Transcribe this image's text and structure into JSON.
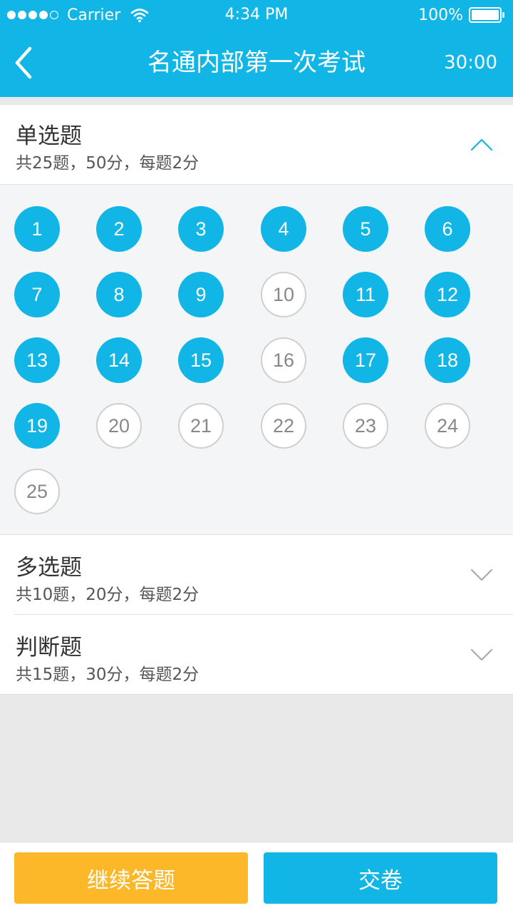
{
  "status_bar": {
    "carrier": "Carrier",
    "time": "4:34 PM",
    "battery": "100%",
    "signal_bars": 4
  },
  "nav": {
    "back_icon": "chevron-left-icon",
    "title": "名通内部第一次考试",
    "timer": "30:00"
  },
  "sections": {
    "single": {
      "title": "单选题",
      "subtitle": "共25题，50分，每题2分",
      "expanded": true,
      "toggle_icon": "chevron-up-icon",
      "questions": [
        {
          "num": "1",
          "answered": true
        },
        {
          "num": "2",
          "answered": true
        },
        {
          "num": "3",
          "answered": true
        },
        {
          "num": "4",
          "answered": true
        },
        {
          "num": "5",
          "answered": true
        },
        {
          "num": "6",
          "answered": true
        },
        {
          "num": "7",
          "answered": true
        },
        {
          "num": "8",
          "answered": true
        },
        {
          "num": "9",
          "answered": true
        },
        {
          "num": "10",
          "answered": false
        },
        {
          "num": "11",
          "answered": true
        },
        {
          "num": "12",
          "answered": true
        },
        {
          "num": "13",
          "answered": true
        },
        {
          "num": "14",
          "answered": true
        },
        {
          "num": "15",
          "answered": true
        },
        {
          "num": "16",
          "answered": false
        },
        {
          "num": "17",
          "answered": true
        },
        {
          "num": "18",
          "answered": true
        },
        {
          "num": "19",
          "answered": true
        },
        {
          "num": "20",
          "answered": false
        },
        {
          "num": "21",
          "answered": false
        },
        {
          "num": "22",
          "answered": false
        },
        {
          "num": "23",
          "answered": false
        },
        {
          "num": "24",
          "answered": false
        },
        {
          "num": "25",
          "answered": false
        }
      ]
    },
    "multiple": {
      "title": "多选题",
      "subtitle": "共10题，20分，每题2分",
      "expanded": false,
      "toggle_icon": "chevron-down-icon"
    },
    "judge": {
      "title": "判断题",
      "subtitle": "共15题，30分，每题2分",
      "expanded": false,
      "toggle_icon": "chevron-down-icon"
    }
  },
  "buttons": {
    "continue_label": "继续答题",
    "submit_label": "交卷"
  },
  "colors": {
    "primary": "#12b6e6",
    "accent": "#fcb829",
    "background": "#e9e9ea"
  }
}
